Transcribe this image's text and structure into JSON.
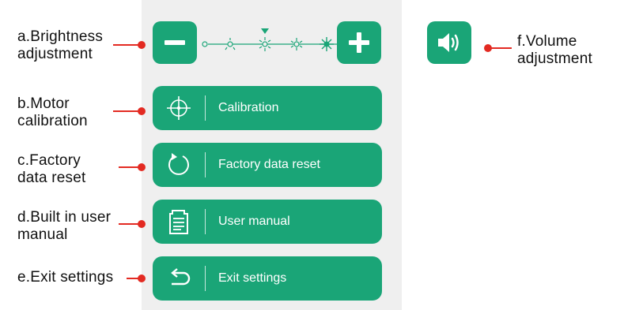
{
  "colors": {
    "accent": "#1aa577",
    "red": "#e32a22",
    "panel": "#efefef"
  },
  "brightness": {
    "decrease_icon": "minus-icon",
    "increase_icon": "plus-icon",
    "levels": [
      "level-1",
      "level-2",
      "level-3",
      "level-4",
      "level-5"
    ],
    "current_level": 3
  },
  "volume": {
    "icon": "speaker-icon"
  },
  "menu": [
    {
      "label": "Calibration",
      "icon": "crosshair-icon"
    },
    {
      "label": "Factory data reset",
      "icon": "reset-icon"
    },
    {
      "label": "User manual",
      "icon": "document-icon"
    },
    {
      "label": "Exit settings",
      "icon": "back-arrow-icon"
    }
  ],
  "callouts": {
    "a": {
      "line1": "a.Brightness",
      "line2": "adjustment"
    },
    "b": {
      "line1": "b.Motor",
      "line2": "calibration"
    },
    "c": {
      "line1": "c.Factory",
      "line2": "data reset"
    },
    "d": {
      "line1": "d.Built in user",
      "line2": "manual"
    },
    "e": {
      "line1": "e.Exit settings"
    },
    "f": {
      "line1": "f.Volume",
      "line2": "adjustment"
    }
  }
}
